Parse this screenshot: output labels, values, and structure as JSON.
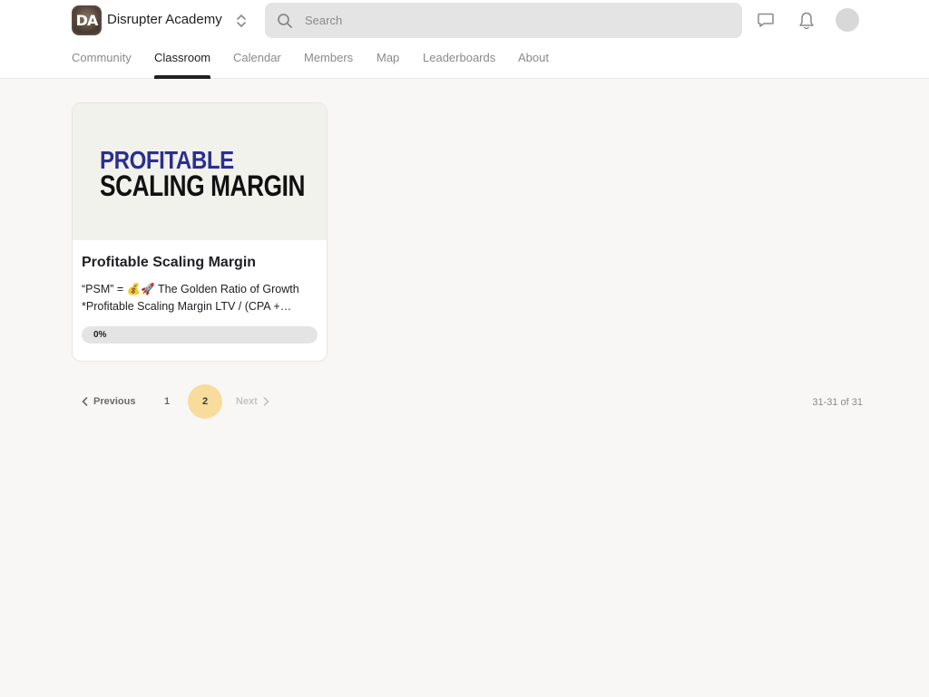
{
  "header": {
    "group_name": "Disrupter Academy",
    "logo_text": "DA",
    "search_placeholder": "Search",
    "icons": [
      "switch-group-icon",
      "search-icon",
      "chat-icon",
      "bell-icon",
      "avatar"
    ]
  },
  "tabs": [
    {
      "label": "Community",
      "active": false
    },
    {
      "label": "Classroom",
      "active": true
    },
    {
      "label": "Calendar",
      "active": false
    },
    {
      "label": "Members",
      "active": false
    },
    {
      "label": "Map",
      "active": false
    },
    {
      "label": "Leaderboards",
      "active": false
    },
    {
      "label": "About",
      "active": false
    }
  ],
  "course": {
    "cover_line1": "PROFITABLE",
    "cover_line2": "SCALING MARGIN",
    "title": "Profitable Scaling Margin",
    "description": "“PSM” = 💰🚀 The Golden Ratio of Growth *Profitable Scaling Margin LTV / (CPA + COGS)",
    "progress_label": "0%",
    "progress_value": 0
  },
  "pagination": {
    "previous_label": "Previous",
    "pages": [
      "1",
      "2"
    ],
    "current_page": "2",
    "next_label": "Next",
    "range_text": "31-31 of 31"
  },
  "colors": {
    "accent_page": "#f8dc9c",
    "cover_title_blue": "#2b2f8f",
    "background": "#f8f7f5"
  }
}
